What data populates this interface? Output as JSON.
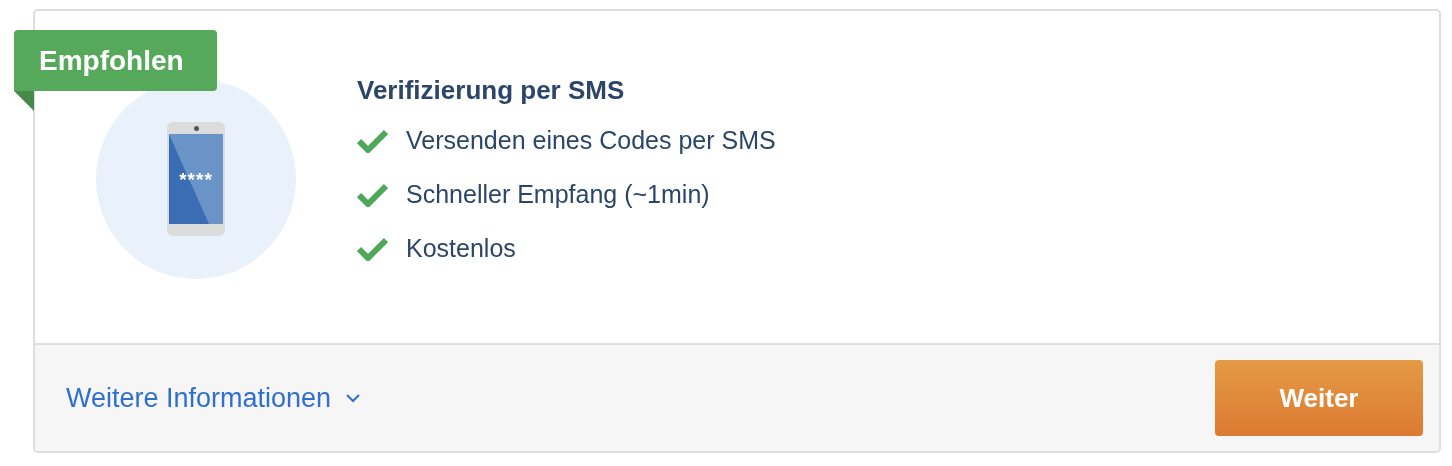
{
  "badge": "Empfohlen",
  "phone_screen": "****",
  "title": "Verifizierung per SMS",
  "features": [
    "Versenden eines Codes per SMS",
    "Schneller Empfang (~1min)",
    "Kostenlos"
  ],
  "footer": {
    "link": "Weitere Informationen",
    "expanded": false,
    "button": "Weiter"
  }
}
